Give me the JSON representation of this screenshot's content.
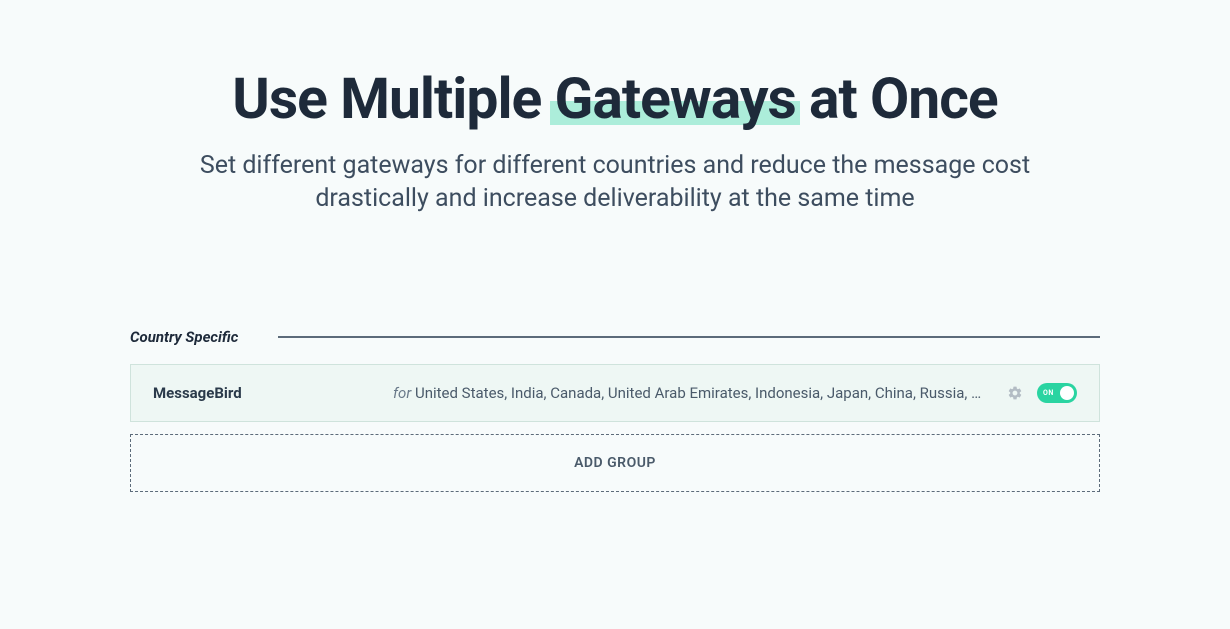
{
  "headline": {
    "pre": "Use Multiple ",
    "highlight": "Gateways",
    "post": " at Once"
  },
  "subhead": "Set different gateways for different countries and reduce the message cost drastically and increase deliverability at the same time",
  "section": {
    "title": "Country Specific",
    "gateway": {
      "name": "MessageBird",
      "for_label": "for ",
      "countries": "United States, India, Canada, United Arab Emirates, Indonesia, Japan, China, Russia, Sin...",
      "toggle": "ON"
    },
    "add_group": "ADD GROUP"
  }
}
